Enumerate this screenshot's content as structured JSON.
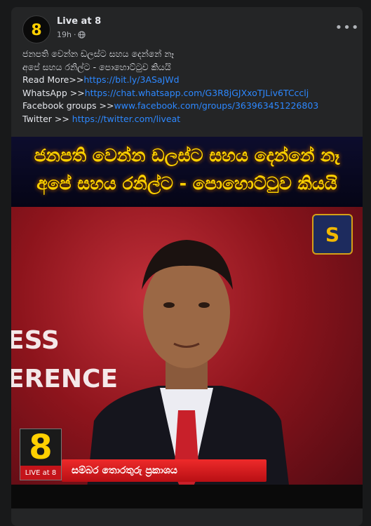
{
  "post": {
    "page_name": "Live at 8",
    "timestamp": "19h",
    "separator": "·",
    "more_label": "•••",
    "lines": [
      {
        "text": "ජනපති වෙන්න ඩලස්ට සහය දෙන්නේ නෑ"
      },
      {
        "text": "අපේ සහය රනිල්ට - පොහොට්ටුව කියයි"
      },
      {
        "prefix": "Read More>>",
        "link": "https://bit.ly/3ASaJWd"
      },
      {
        "prefix": "WhatsApp >>",
        "link": "https://chat.whatsapp.com/G3R8jGJXxoTJLiv6TCcclj"
      },
      {
        "prefix": "Facebook groups >>",
        "link": "www.facebook.com/groups/363963451226803"
      },
      {
        "prefix": "Twitter >> ",
        "link": "https://twitter.com/liveat"
      }
    ]
  },
  "media": {
    "headline_1": "ජනපති වෙන්න ඩලස්ට සහය දෙන්නේ නෑ",
    "headline_2": "අපේ සහය රනිල්ට - පොහොට්ටුව කියයි",
    "backdrop_1": "ESS",
    "backdrop_2": "ERENCE",
    "channel_badge": "S",
    "logo_number": "8",
    "logo_label": "LIVE at 8",
    "lower_third": "සම්බර තොරතුරු ප්‍රකාශය"
  },
  "colors": {
    "background": "#18191a",
    "card": "#242526",
    "link": "#2d88ff",
    "headline": "#ffd000",
    "lower_third": "#e01e22"
  },
  "icons": {
    "avatar": "live-at-8-logo",
    "audience": "globe-icon",
    "more": "more-options-icon"
  }
}
